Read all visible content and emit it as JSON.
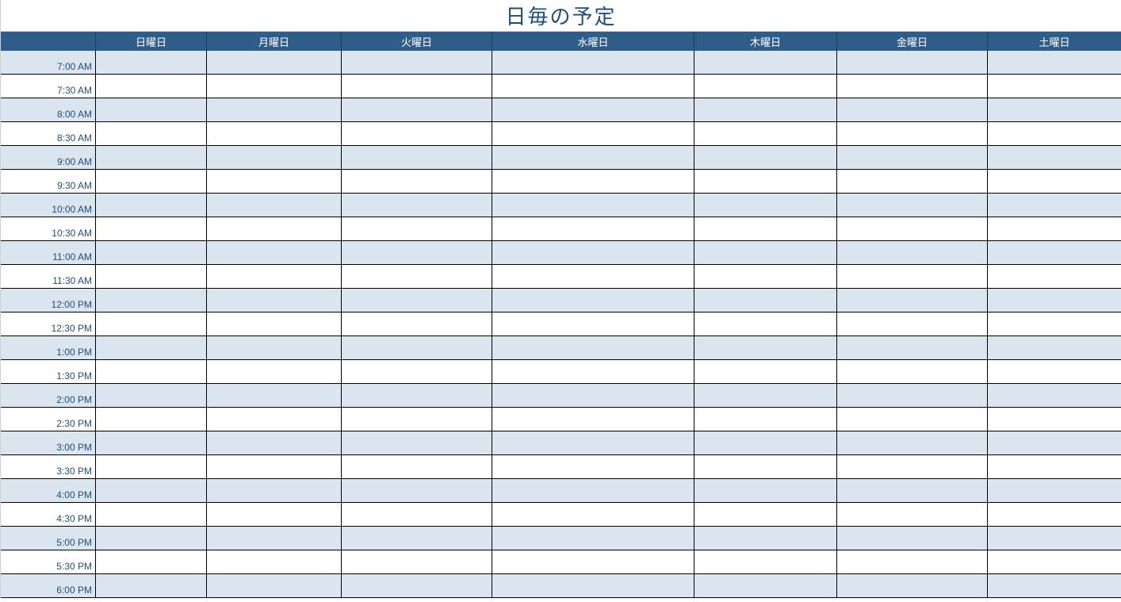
{
  "title": "日毎の予定",
  "days": [
    "日曜日",
    "月曜日",
    "火曜日",
    "水曜日",
    "木曜日",
    "金曜日",
    "土曜日"
  ],
  "times": [
    "7:00 AM",
    "7:30 AM",
    "8:00 AM",
    "8:30 AM",
    "9:00 AM",
    "9:30 AM",
    "10:00 AM",
    "10:30 AM",
    "11:00 AM",
    "11:30 AM",
    "12:00 PM",
    "12:30 PM",
    "1:00 PM",
    "1:30 PM",
    "2:00 PM",
    "2:30 PM",
    "3:00 PM",
    "3:30 PM",
    "4:00 PM",
    "4:30 PM",
    "5:00 PM",
    "5:30 PM",
    "6:00 PM"
  ],
  "cells": {}
}
